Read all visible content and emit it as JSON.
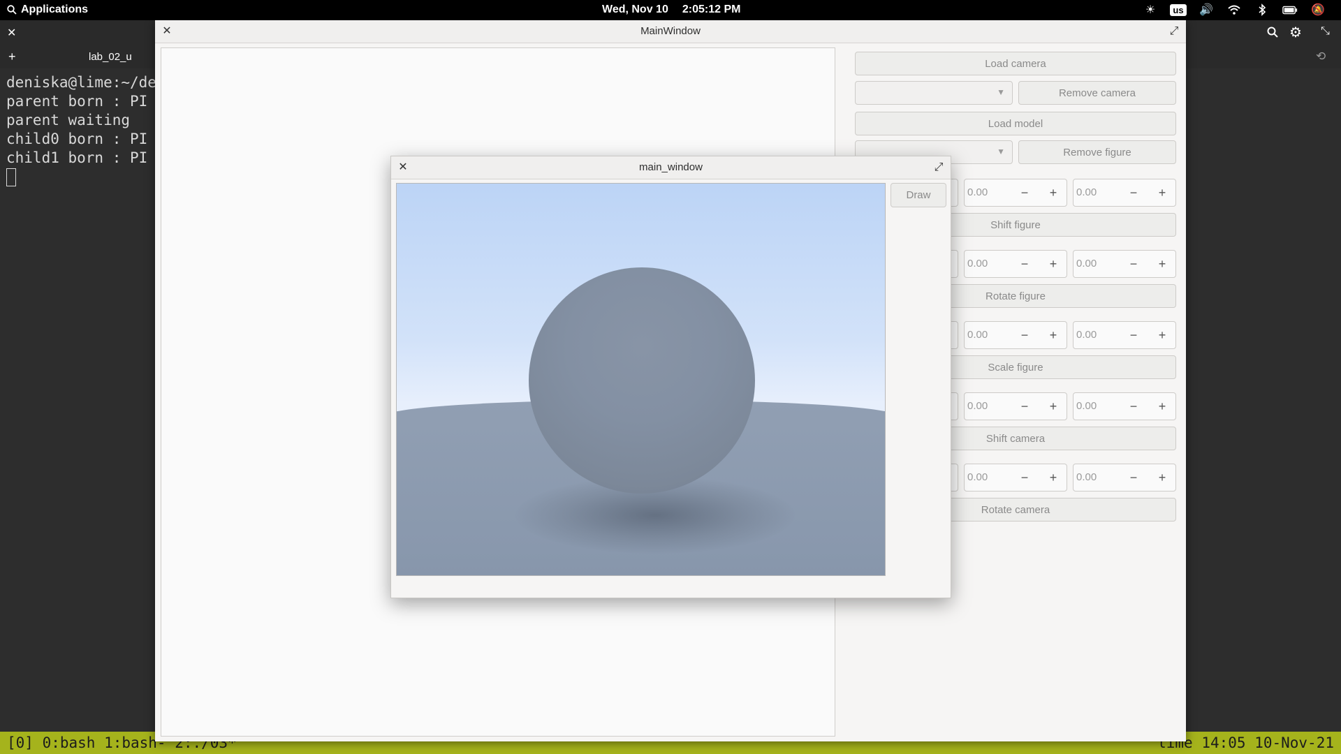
{
  "topbar": {
    "apps_label": "Applications",
    "date": "Wed, Nov 10",
    "time": "2:05:12 PM",
    "kbd_layout": "us"
  },
  "terminal": {
    "tab_label": "lab_02_u",
    "lines": [
      "deniska@lime:~/de",
      "parent born : PI",
      "parent waiting",
      "child0 born : PI",
      "child1 born : PI"
    ],
    "tmux_left": "[0] 0:bash  1:bash- 2:./03*",
    "tmux_right": "lime  14:05 10-Nov-21"
  },
  "main_window": {
    "title": "MainWindow",
    "load_camera": "Load camera",
    "remove_camera": "Remove camera",
    "load_model": "Load model",
    "remove_figure": "Remove figure",
    "shift_figure": "Shift figure",
    "rotate_figure": "Rotate figure",
    "scale_figure": "Scale figure",
    "shift_camera": "Shift camera",
    "rotate_camera": "Rotate camera",
    "spin_value": "0.00"
  },
  "dialog": {
    "title": "main_window",
    "draw_label": "Draw"
  },
  "colors": {
    "tmux_bar": "#a5b31c",
    "sky_top": "#bcd4f6",
    "sphere": "#8390a3"
  }
}
